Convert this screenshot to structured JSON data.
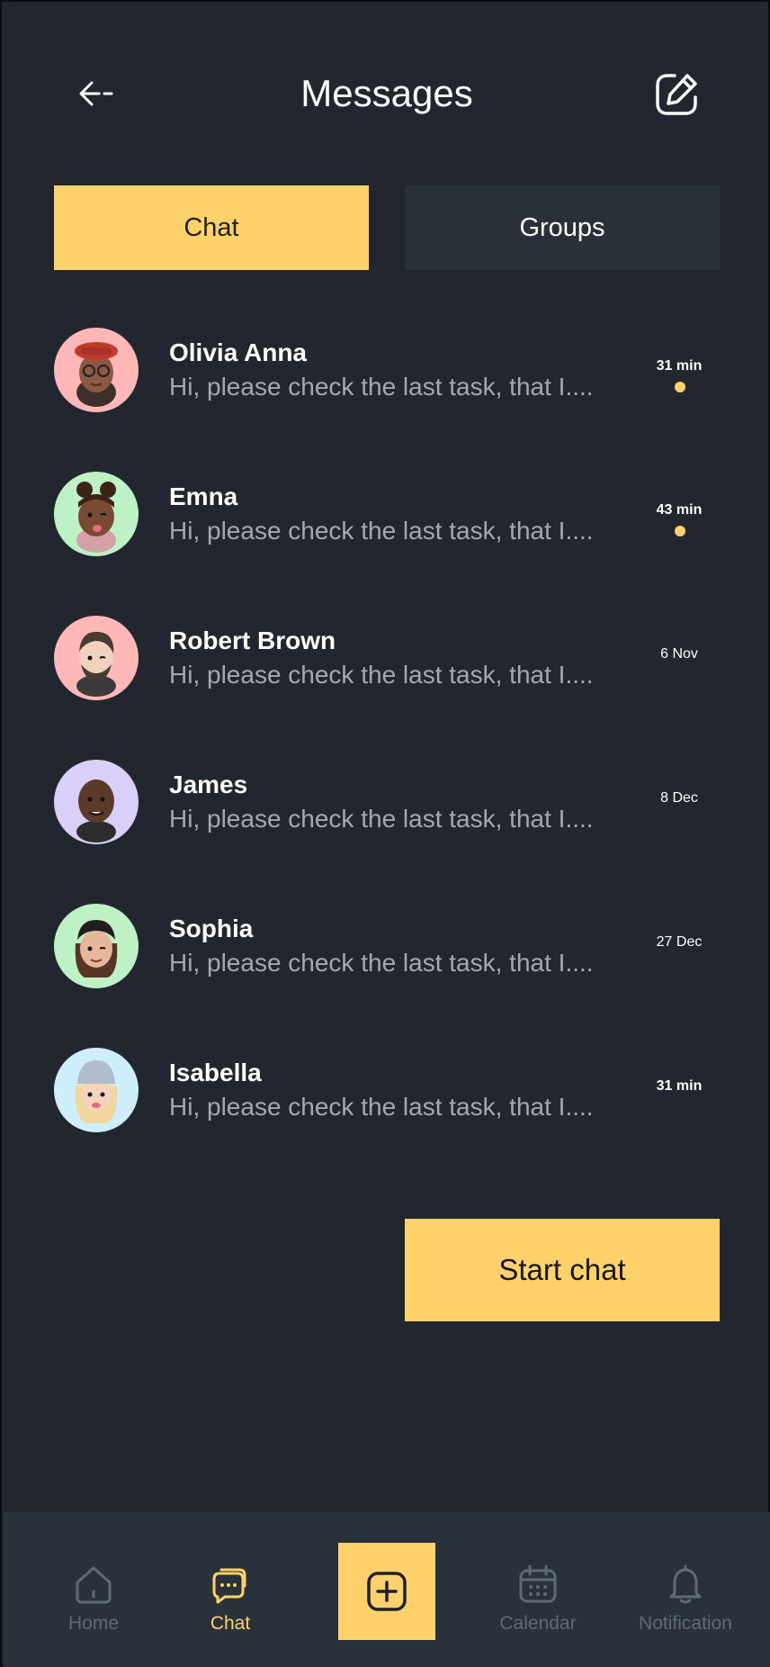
{
  "header": {
    "title": "Messages",
    "back_icon": "arrow-left-icon",
    "compose_icon": "edit-square-icon"
  },
  "tabs": [
    {
      "label": "Chat",
      "active": true
    },
    {
      "label": "Groups",
      "active": false
    }
  ],
  "chats": [
    {
      "name": "Olivia Anna",
      "preview": "Hi, please check the last task, that I....",
      "time": "31 min",
      "unread": true,
      "avatar_bg": "#ffb7b7"
    },
    {
      "name": "Emna",
      "preview": "Hi, please check the last task, that I....",
      "time": "43 min",
      "unread": true,
      "avatar_bg": "#bff1c6"
    },
    {
      "name": "Robert Brown",
      "preview": "Hi, please check the last task, that I....",
      "time": "6 Nov",
      "unread": false,
      "avatar_bg": "#ffb7b7"
    },
    {
      "name": "James",
      "preview": "Hi, please check the last task, that I....",
      "time": "8 Dec",
      "unread": false,
      "avatar_bg": "#d9cff9"
    },
    {
      "name": "Sophia",
      "preview": "Hi, please check the last task, that I....",
      "time": "27 Dec",
      "unread": false,
      "avatar_bg": "#bff1c6"
    },
    {
      "name": "Isabella",
      "preview": "Hi, please check the last task, that I....",
      "time": "31 min",
      "unread": false,
      "avatar_bg": "#cfeefc"
    }
  ],
  "start_chat": {
    "label": "Start chat"
  },
  "nav": {
    "home": {
      "label": "Home",
      "icon": "home-icon"
    },
    "chat": {
      "label": "Chat",
      "icon": "chat-bubbles-icon"
    },
    "add": {
      "icon": "plus-square-icon"
    },
    "calendar": {
      "label": "Calendar",
      "icon": "calendar-icon"
    },
    "notification": {
      "label": "Notification",
      "icon": "bell-icon"
    }
  },
  "colors": {
    "background": "#22262f",
    "accent": "#fed16a",
    "nav_background": "#29323a",
    "inactive_tab": "#2a3038",
    "muted_text": "#a5a8ae",
    "nav_muted": "#5d6b74"
  }
}
